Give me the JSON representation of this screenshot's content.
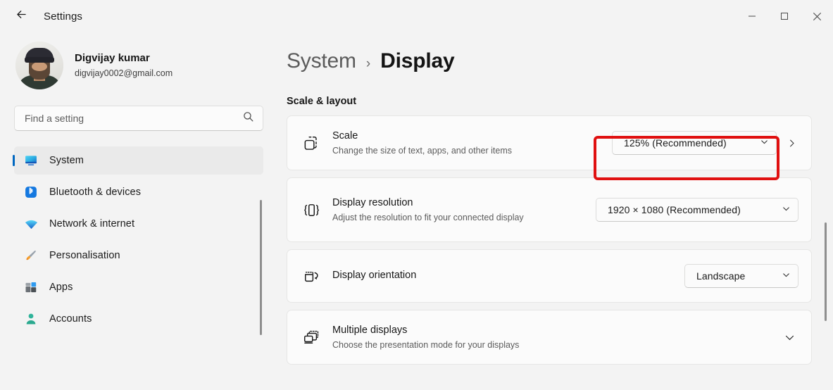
{
  "window": {
    "title": "Settings",
    "back_icon": "back-arrow-icon",
    "minimize_label": "Minimize",
    "maximize_label": "Maximize",
    "close_label": "Close"
  },
  "profile": {
    "name": "Digvijay kumar",
    "email": "digvijay0002@gmail.com",
    "avatar_alt": "user-avatar"
  },
  "search": {
    "placeholder": "Find a setting",
    "value": "",
    "icon": "search-icon"
  },
  "sidebar": {
    "items": [
      {
        "label": "System",
        "icon": "monitor-icon",
        "active": true
      },
      {
        "label": "Bluetooth & devices",
        "icon": "bluetooth-icon",
        "active": false
      },
      {
        "label": "Network & internet",
        "icon": "wifi-icon",
        "active": false
      },
      {
        "label": "Personalisation",
        "icon": "paintbrush-icon",
        "active": false
      },
      {
        "label": "Apps",
        "icon": "apps-icon",
        "active": false
      },
      {
        "label": "Accounts",
        "icon": "person-icon",
        "active": false
      }
    ]
  },
  "breadcrumb": {
    "parent": "System",
    "separator": "›",
    "current": "Display"
  },
  "main": {
    "section_title": "Scale & layout",
    "cards": [
      {
        "title": "Scale",
        "subtitle": "Change the size of text, apps, and other items",
        "icon": "scale-icon",
        "control": "combo",
        "value": "125% (Recommended)",
        "trailing": "chevron-right",
        "highlighted": true
      },
      {
        "title": "Display resolution",
        "subtitle": "Adjust the resolution to fit your connected display",
        "icon": "resolution-icon",
        "control": "combo",
        "value": "1920 × 1080 (Recommended)",
        "trailing": "none",
        "highlighted": false
      },
      {
        "title": "Display orientation",
        "subtitle": "",
        "icon": "rotate-icon",
        "control": "combo",
        "value": "Landscape",
        "trailing": "none",
        "highlighted": false
      },
      {
        "title": "Multiple displays",
        "subtitle": "Choose the presentation mode for your displays",
        "icon": "multiple-displays-icon",
        "control": "expander",
        "value": "",
        "trailing": "chevron-down",
        "highlighted": false
      }
    ]
  },
  "colors": {
    "accent": "#0067c0",
    "highlight": "#e01010",
    "page_bg": "#f3f3f3",
    "card_bg": "#fbfbfb"
  }
}
